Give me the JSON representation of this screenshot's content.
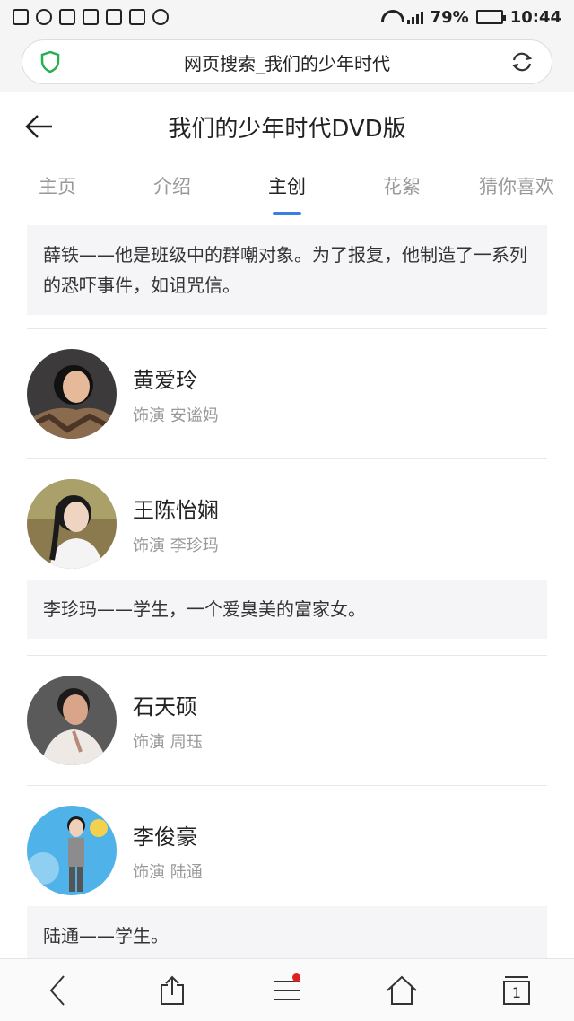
{
  "status_bar": {
    "battery": "79%",
    "time": "10:44",
    "battery_level": 0.79
  },
  "url_bar": {
    "text": "网页搜索_我们的少年时代"
  },
  "header": {
    "title": "我们的少年时代DVD版"
  },
  "tabs": [
    {
      "label": "主页"
    },
    {
      "label": "介绍"
    },
    {
      "label": "主创"
    },
    {
      "label": "花絮"
    },
    {
      "label": "猜你喜欢"
    }
  ],
  "active_tab": 2,
  "content": {
    "desc_top": "薛铁——他是班级中的群嘲对象。为了报复，他制造了一系列的恐吓事件，如诅咒信。",
    "people": [
      {
        "name": "黄爱玲",
        "role": "饰演 安谧妈"
      },
      {
        "name": "王陈怡娴",
        "role": "饰演 李珍玛"
      },
      {
        "name": "石天硕",
        "role": "饰演 周珏"
      },
      {
        "name": "李俊豪",
        "role": "饰演 陆通"
      }
    ],
    "desc_wang": "李珍玛——学生，一个爱臭美的富家女。",
    "desc_li": "陆通——学生。"
  },
  "bottom_bar": {
    "tabs_count": "1"
  },
  "colors": {
    "accent": "#3a7ee8",
    "shield": "#22b14c",
    "notify_dot": "#e02020"
  }
}
